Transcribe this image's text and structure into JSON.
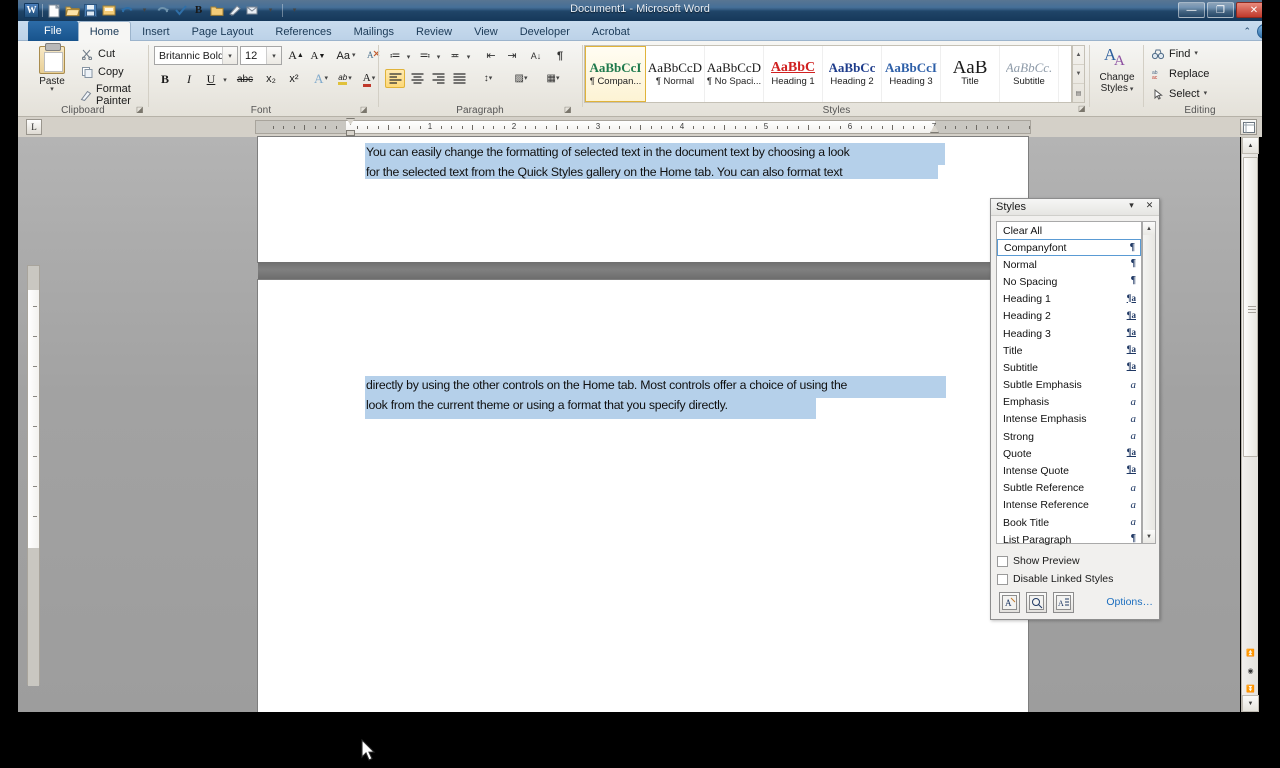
{
  "window": {
    "title": "Document1 - Microsoft Word",
    "minimize_label": "—",
    "maximize_label": "❐",
    "close_label": "✕"
  },
  "quick_access": {
    "logo": "W",
    "items": [
      {
        "name": "new-document",
        "glyph": "🗋"
      },
      {
        "name": "open",
        "glyph": "📂"
      },
      {
        "name": "save",
        "glyph": "💾"
      },
      {
        "name": "print",
        "glyph": "🗂"
      },
      {
        "name": "undo",
        "glyph": "↺"
      },
      {
        "name": "undo-dropdown",
        "glyph": "▾"
      },
      {
        "name": "redo",
        "glyph": "↻"
      },
      {
        "name": "spelling-check",
        "glyph": "✓"
      },
      {
        "name": "bold",
        "glyph": "B"
      },
      {
        "name": "folder",
        "glyph": "🗂"
      },
      {
        "name": "format-painter",
        "glyph": "✎"
      },
      {
        "name": "email",
        "glyph": "✉"
      },
      {
        "name": "more",
        "glyph": "▾"
      },
      {
        "name": "customize",
        "glyph": "▾"
      }
    ]
  },
  "ribbon": {
    "tabs": [
      {
        "label": "File",
        "active": false,
        "kind": "file"
      },
      {
        "label": "Home",
        "active": true,
        "kind": "normal"
      },
      {
        "label": "Insert",
        "active": false,
        "kind": "normal"
      },
      {
        "label": "Page Layout",
        "active": false,
        "kind": "normal"
      },
      {
        "label": "References",
        "active": false,
        "kind": "normal"
      },
      {
        "label": "Mailings",
        "active": false,
        "kind": "normal"
      },
      {
        "label": "Review",
        "active": false,
        "kind": "normal"
      },
      {
        "label": "View",
        "active": false,
        "kind": "normal"
      },
      {
        "label": "Developer",
        "active": false,
        "kind": "normal"
      },
      {
        "label": "Acrobat",
        "active": false,
        "kind": "normal"
      }
    ],
    "help_label": "?",
    "minimize_ribbon_label": "^",
    "groups": {
      "clipboard": {
        "label": "Clipboard",
        "paste_label": "Paste",
        "cut_label": "Cut",
        "copy_label": "Copy",
        "format_painter_label": "Format Painter"
      },
      "font": {
        "label": "Font",
        "font_name": "Britannic Bold",
        "font_size": "12",
        "grow_font": "A",
        "shrink_font": "A",
        "change_case": "Aa",
        "clear_formatting": "⌫",
        "bold": "B",
        "italic": "I",
        "underline": "U",
        "strikethrough": "abc",
        "subscript": "x₂",
        "superscript": "x²",
        "text_effects": "A",
        "highlight": "ab",
        "font_color": "A"
      },
      "paragraph": {
        "label": "Paragraph",
        "bullets": "≔",
        "numbering": "≕",
        "multilevel": "≖",
        "decrease_indent": "⇤",
        "increase_indent": "⇥",
        "sort": "↓",
        "show_marks": "¶",
        "align_left": "≡",
        "align_center": "≡",
        "align_right": "≡",
        "justify": "≡",
        "line_spacing": "↕",
        "shading": "▨",
        "borders": "▦"
      },
      "styles": {
        "label": "Styles",
        "items": [
          {
            "preview": "AaBbCcI",
            "name": "¶ Compan...",
            "color": "#1f7a4d",
            "selected": true
          },
          {
            "preview": "AaBbCcD",
            "name": "¶ Normal",
            "color": "#1a1a1a",
            "selected": false
          },
          {
            "preview": "AaBbCcD",
            "name": "¶ No Spaci...",
            "color": "#1a1a1a",
            "selected": false
          },
          {
            "preview": "AaBbC",
            "name": "Heading 1",
            "color": "#d02020",
            "selected": false
          },
          {
            "preview": "AaBbCc",
            "name": "Heading 2",
            "color": "#1f3d8c",
            "selected": false
          },
          {
            "preview": "AaBbCcI",
            "name": "Heading 3",
            "color": "#2d5fa8",
            "selected": false
          },
          {
            "preview": "AaB",
            "name": "Title",
            "color": "#1a1a1a",
            "selected": false
          },
          {
            "preview": "AaBbCc.",
            "name": "Subtitle",
            "color": "#8d9aa8",
            "selected": false
          }
        ],
        "scroll_up": "▲",
        "scroll_down": "▼",
        "scroll_more": "▤"
      },
      "change_styles": {
        "label_line1": "Change",
        "label_line2": "Styles",
        "icon": "A"
      },
      "editing": {
        "label": "Editing",
        "find_label": "Find",
        "replace_label": "Replace",
        "select_label": "Select"
      }
    }
  },
  "ruler": {
    "tab_selector": "L",
    "marks": [
      "1",
      "2",
      "3",
      "4",
      "5",
      "6",
      "7"
    ],
    "page_setup_icon": "⊞"
  },
  "document": {
    "page1": {
      "lines": [
        "You can easily change the formatting of selected text in the document text by choosing a look",
        "for the selected text from the Quick Styles gallery on the Home tab. You can also format text"
      ]
    },
    "page2": {
      "lines": [
        "directly by using the other controls on the Home tab. Most controls offer a choice of using the",
        "look from the current theme or using a format that you specify directly."
      ]
    },
    "selection_color": "#b5d0ea"
  },
  "scrollbar": {
    "up_arrow": "▲",
    "down_arrow": "▼",
    "previous_page": "⏫",
    "browse_object": "◉",
    "next_page": "⏬"
  },
  "styles_pane": {
    "title": "Styles",
    "dropdown_glyph": "▾",
    "close_glyph": "✕",
    "scroll_up": "▲",
    "scroll_down": "▼",
    "items": [
      {
        "label": "Clear All",
        "mark": "",
        "mark_type": "none",
        "selected": false
      },
      {
        "label": "Companyfont",
        "mark": "¶",
        "mark_type": "para",
        "selected": true
      },
      {
        "label": "Normal",
        "mark": "¶",
        "mark_type": "para",
        "selected": false
      },
      {
        "label": "No Spacing",
        "mark": "¶",
        "mark_type": "para",
        "selected": false
      },
      {
        "label": "Heading 1",
        "mark": "¶a",
        "mark_type": "linked",
        "selected": false
      },
      {
        "label": "Heading 2",
        "mark": "¶a",
        "mark_type": "linked",
        "selected": false
      },
      {
        "label": "Heading 3",
        "mark": "¶a",
        "mark_type": "linked",
        "selected": false
      },
      {
        "label": "Title",
        "mark": "¶a",
        "mark_type": "linked",
        "selected": false
      },
      {
        "label": "Subtitle",
        "mark": "¶a",
        "mark_type": "linked",
        "selected": false
      },
      {
        "label": "Subtle Emphasis",
        "mark": "a",
        "mark_type": "char",
        "selected": false
      },
      {
        "label": "Emphasis",
        "mark": "a",
        "mark_type": "char",
        "selected": false
      },
      {
        "label": "Intense Emphasis",
        "mark": "a",
        "mark_type": "char",
        "selected": false
      },
      {
        "label": "Strong",
        "mark": "a",
        "mark_type": "char",
        "selected": false
      },
      {
        "label": "Quote",
        "mark": "¶a",
        "mark_type": "linked",
        "selected": false
      },
      {
        "label": "Intense Quote",
        "mark": "¶a",
        "mark_type": "linked",
        "selected": false
      },
      {
        "label": "Subtle Reference",
        "mark": "a",
        "mark_type": "char",
        "selected": false
      },
      {
        "label": "Intense Reference",
        "mark": "a",
        "mark_type": "char",
        "selected": false
      },
      {
        "label": "Book Title",
        "mark": "a",
        "mark_type": "char",
        "selected": false
      },
      {
        "label": "List Paragraph",
        "mark": "¶",
        "mark_type": "para",
        "selected": false
      }
    ],
    "show_preview_label": "Show Preview",
    "disable_linked_label": "Disable Linked Styles",
    "buttons": [
      {
        "name": "new-style-button",
        "glyph": "A"
      },
      {
        "name": "style-inspector-button",
        "glyph": "A"
      },
      {
        "name": "manage-styles-button",
        "glyph": "A"
      }
    ],
    "options_label": "Options…",
    "accent_color": "#1d6fbf"
  }
}
